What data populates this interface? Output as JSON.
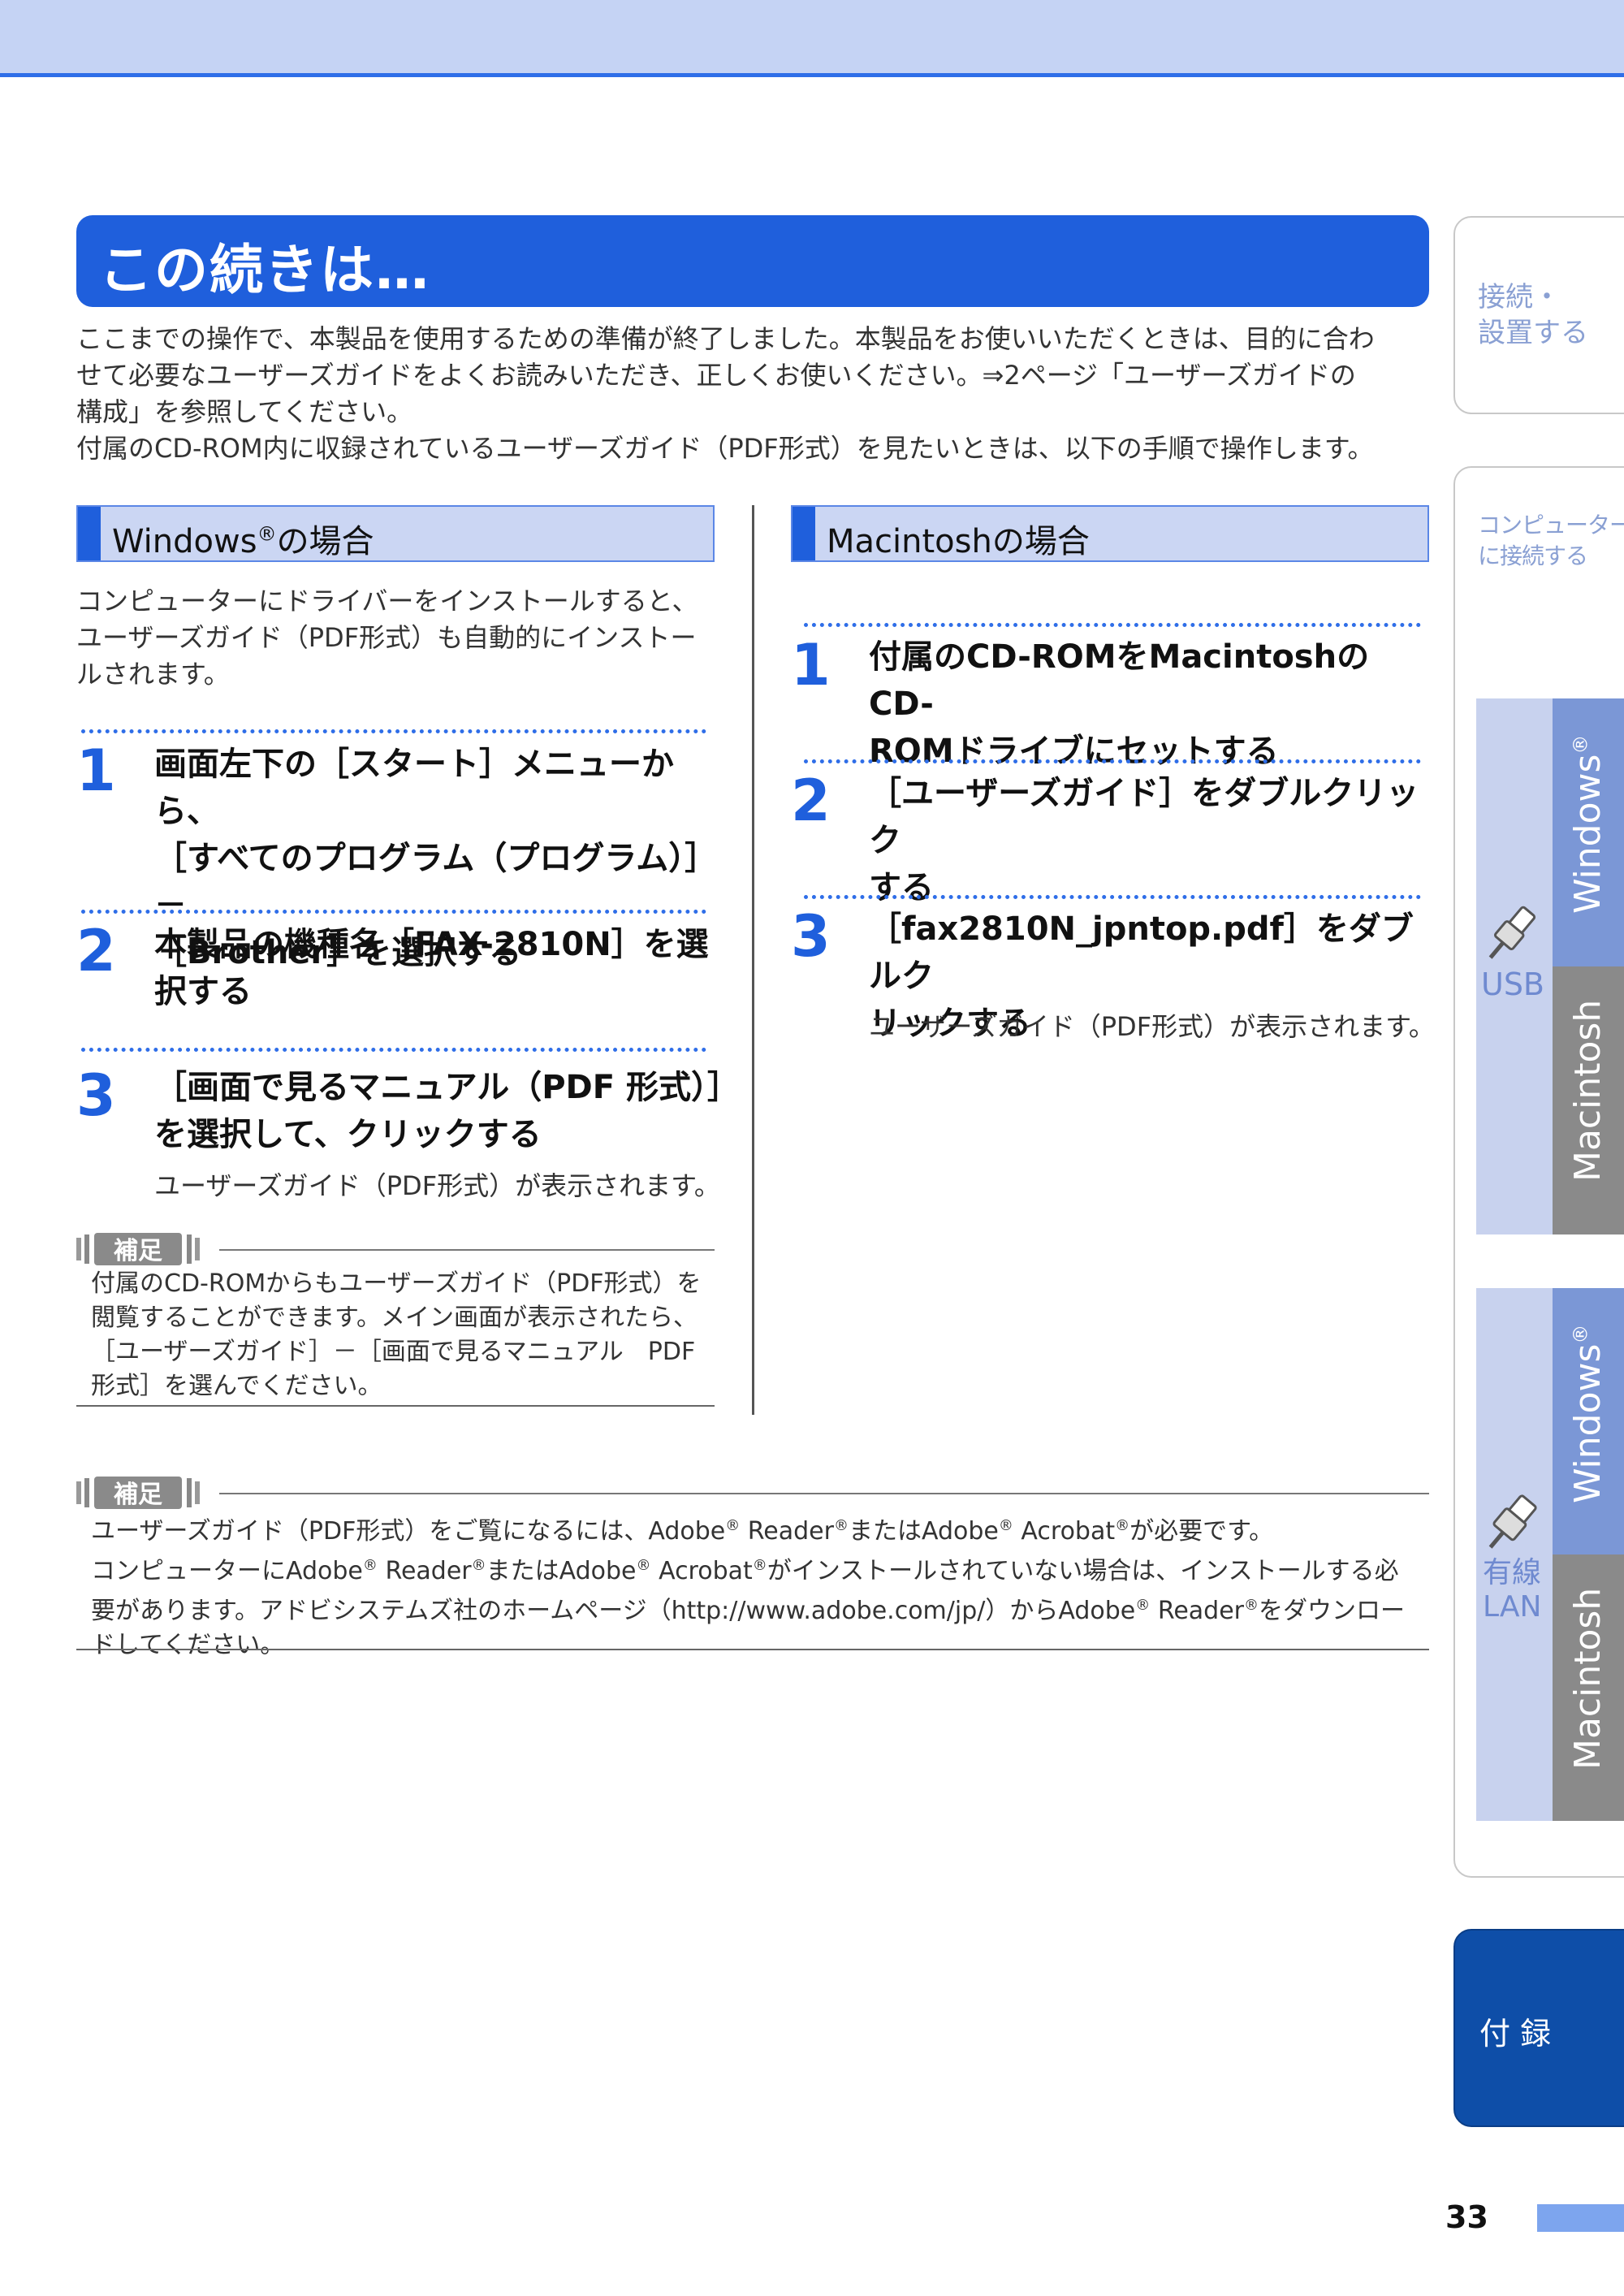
{
  "title": "この続きは…",
  "intro": [
    "ここまでの操作で、本製品を使用するための準備が終了しました。本製品をお使いいただくときは、目的に合わ",
    "せて必要なユーザーズガイドをよくお読みいただき、正しくお使いください。⇒2ページ「ユーザーズガイドの",
    "構成」を参照してください。",
    "付属のCD-ROM内に収録されているユーザーズガイド（PDF形式）を見たいときは、以下の手順で操作します。"
  ],
  "windows": {
    "heading_main": "Windows",
    "heading_sup": "®",
    "heading_tail": "の場合",
    "desc": [
      "コンピューターにドライバーをインストールすると、",
      "ユーザーズガイド（PDF形式）も自動的にインストー",
      "ルされます。"
    ],
    "steps": [
      {
        "num": "1",
        "lines": [
          "画面左下の［スタート］メニューから、",
          "［すべてのプログラム（プログラム）］－",
          "［Brother］を選択する"
        ]
      },
      {
        "num": "2",
        "lines": [
          "本製品の機種名［FAX-2810N］を選",
          "択する"
        ]
      },
      {
        "num": "3",
        "lines": [
          "［画面で見るマニュアル（PDF 形式）］",
          "を選択して、クリックする"
        ],
        "sub": "ユーザーズガイド（PDF形式）が表示されます。"
      }
    ],
    "note_label": "補足",
    "note": [
      "付属のCD-ROMからもユーザーズガイド（PDF形式）を",
      "閲覧することができます。メイン画面が表示されたら、",
      "［ユーザーズガイド］－［画面で見るマニュアル　PDF",
      "形式］を選んでください。"
    ]
  },
  "mac": {
    "heading": "Macintoshの場合",
    "steps": [
      {
        "num": "1",
        "lines": [
          "付属のCD-ROMをMacintoshのCD-",
          "ROMドライブにセットする"
        ]
      },
      {
        "num": "2",
        "lines": [
          "［ユーザーズガイド］をダブルクリック",
          "する"
        ]
      },
      {
        "num": "3",
        "lines": [
          "［fax2810N_jpntop.pdf］をダブルク",
          "リックする"
        ],
        "sub": "ユーザーズガイド（PDF形式）が表示されます。"
      }
    ]
  },
  "bottom_note": {
    "label": "補足",
    "line1_a": "ユーザーズガイド（PDF形式）をご覧になるには、Adobe",
    "line1_b": " Reader",
    "line1_c": "またはAdobe",
    "line1_d": " Acrobat",
    "line1_e": "が必要です。",
    "line2_a": "コンピューターにAdobe",
    "line2_b": " Reader",
    "line2_c": "またはAdobe",
    "line2_d": " Acrobat",
    "line2_e": "がインストールされていない場合は、インストールする必",
    "line3_a": "要があります。アドビシステムズ社のホームページ（http://www.adobe.com/jp/）からAdobe",
    "line3_b": " Reader",
    "line3_c": "をダウンロー",
    "line4": "ドしてください。",
    "reg": "®"
  },
  "sidebar": {
    "tab1": [
      "接続・",
      "設置する"
    ],
    "tab2": [
      "コンピューター",
      "に接続する"
    ],
    "usb_label": "USB",
    "lan_label": [
      "有線",
      "LAN"
    ],
    "windows": "Windows",
    "windows_sup": "®",
    "macintosh": "Macintosh",
    "appendix": "付 録",
    "colors": {
      "light_blue": "#c8d2ee",
      "blue": "#7b97d6",
      "gray": "#8a8a8a",
      "navy": "#0e4ea8"
    }
  },
  "page_number": "33"
}
